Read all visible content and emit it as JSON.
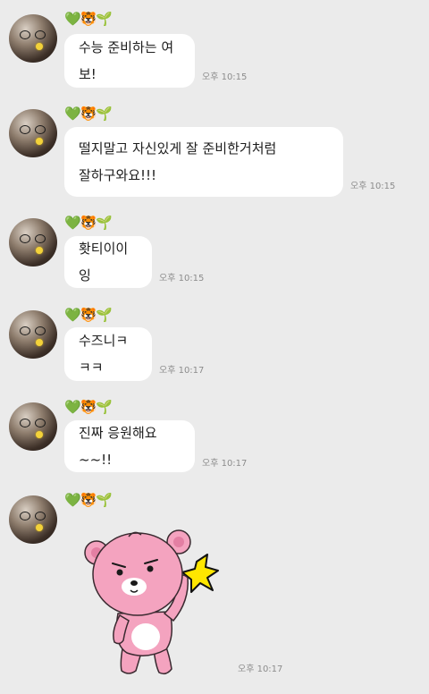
{
  "sender": {
    "display_name": "💚🐯🌱"
  },
  "messages": [
    {
      "text": "수능 준비하는 여보!",
      "time": "오후 10:15"
    },
    {
      "text": "떨지말고 자신있게 잘 준비한거처럼\n잘하구와요!!!",
      "time": "오후 10:15"
    },
    {
      "text": "홧티이이잉",
      "time": "오후 10:15"
    },
    {
      "text": "수즈니ㅋㅋㅋ",
      "time": "오후 10:17"
    },
    {
      "text": "진짜 응원해요~~!!",
      "time": "오후 10:17"
    }
  ],
  "sticker_message": {
    "sticker": "pink-bear-salute-sticker",
    "time": "오후 10:17"
  },
  "colors": {
    "background": "#ebebeb",
    "bubble": "#ffffff",
    "time_text": "#8c8c8c",
    "sticker_bear": "#f4a3bf"
  }
}
